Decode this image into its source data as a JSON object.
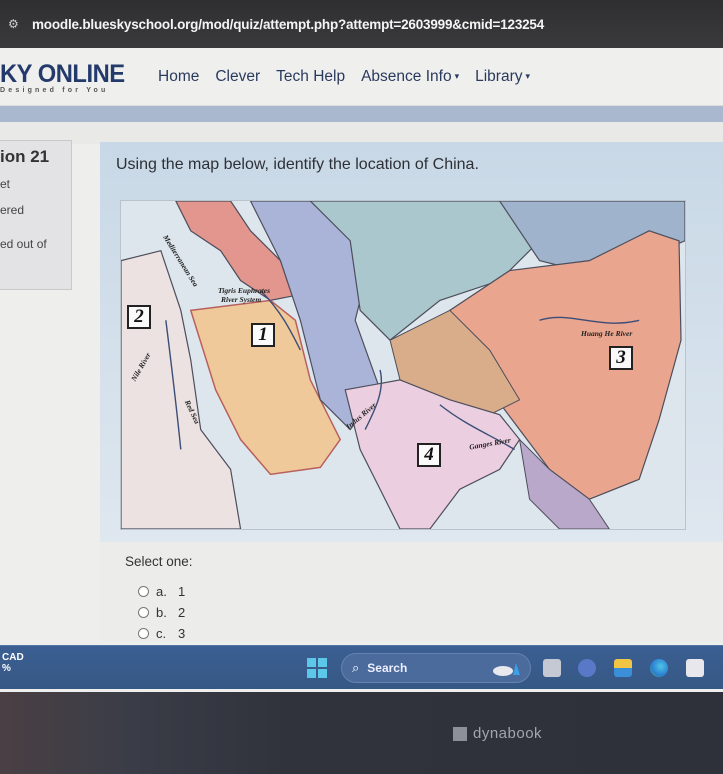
{
  "browser": {
    "url": "moodle.blueskyschool.org/mod/quiz/attempt.php?attempt=2603999&cmid=123254",
    "site_icon": "tune-icon"
  },
  "site": {
    "brand_name": "KY ONLINE",
    "brand_tagline": "Designed for You",
    "nav": [
      {
        "label": "Home",
        "dropdown": false
      },
      {
        "label": "Clever",
        "dropdown": false
      },
      {
        "label": "Tech Help",
        "dropdown": false
      },
      {
        "label": "Absence Info",
        "dropdown": true
      },
      {
        "label": "Library",
        "dropdown": true
      }
    ]
  },
  "question_info": {
    "number": "ion 21",
    "lines": [
      "et",
      "ered",
      "ed out of"
    ]
  },
  "question": {
    "text": "Using the map below, identify the location of China.",
    "map": {
      "markers": [
        "1",
        "2",
        "3",
        "4"
      ],
      "labels": {
        "mediterranean": "Mediterranean Sea",
        "tigris": "Tigris Euphrates",
        "tigris2": "River System",
        "nile": "Nile River",
        "red_sea": "Red Sea",
        "indus": "Indus River",
        "ganges": "Ganges River",
        "huang_he": "Huang He River"
      }
    },
    "prompt": "Select one:",
    "options": [
      {
        "letter": "a.",
        "value": "1",
        "selected": false
      },
      {
        "letter": "b.",
        "value": "2",
        "selected": false
      },
      {
        "letter": "c.",
        "value": "3",
        "selected": false
      }
    ]
  },
  "taskbar": {
    "left_text_1": "CAD",
    "left_text_2": "%",
    "search_label": "Search",
    "icons": [
      "task-view-icon",
      "chat-icon",
      "file-explorer-icon",
      "edge-icon",
      "store-icon"
    ]
  },
  "device": {
    "brand": "dynabook"
  }
}
